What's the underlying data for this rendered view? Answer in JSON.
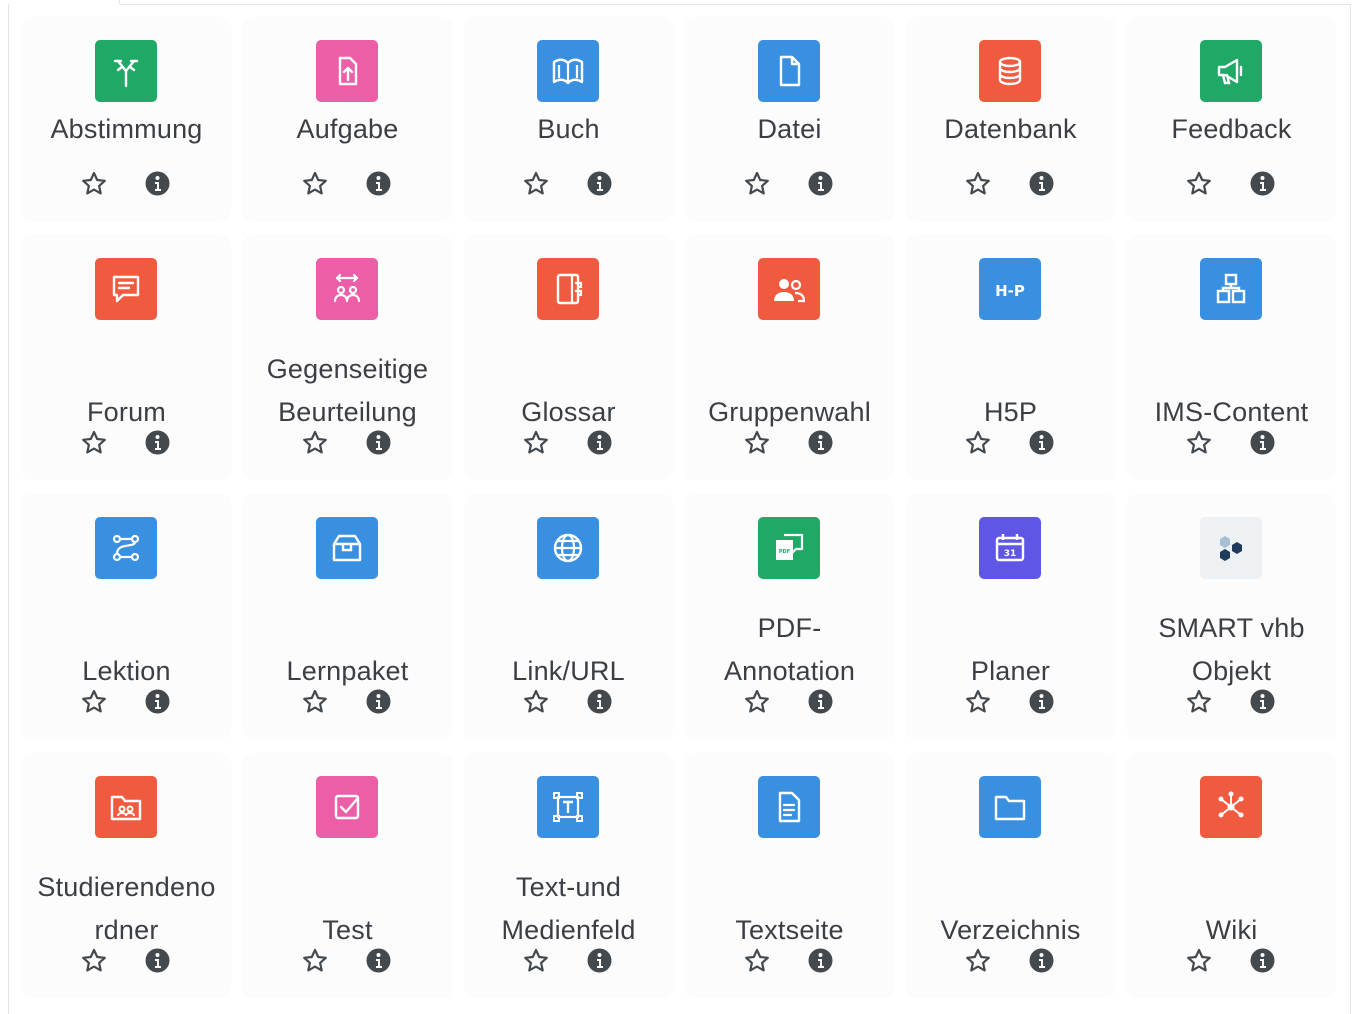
{
  "activities": [
    {
      "label": "Abstimmung",
      "icon": "choice-icon",
      "color": "#1fa866"
    },
    {
      "label": "Aufgabe",
      "icon": "assignment-icon",
      "color": "#ec5fa8"
    },
    {
      "label": "Buch",
      "icon": "book-icon",
      "color": "#3a90e0"
    },
    {
      "label": "Datei",
      "icon": "file-icon",
      "color": "#3a90e0"
    },
    {
      "label": "Datenbank",
      "icon": "database-icon",
      "color": "#f05a3e"
    },
    {
      "label": "Feedback",
      "icon": "megaphone-icon",
      "color": "#1fa866"
    },
    {
      "label": "Forum",
      "icon": "forum-icon",
      "color": "#f05a3e"
    },
    {
      "label": "Gegenseitige Beurteilung",
      "icon": "workshop-icon",
      "color": "#ec5fa8"
    },
    {
      "label": "Glossar",
      "icon": "glossary-icon",
      "color": "#f05a3e"
    },
    {
      "label": "Gruppenwahl",
      "icon": "group-icon",
      "color": "#f05a3e"
    },
    {
      "label": "H5P",
      "icon": "h5p-icon",
      "color": "#3a90e0"
    },
    {
      "label": "IMS-Content",
      "icon": "ims-icon",
      "color": "#3a90e0"
    },
    {
      "label": "Lektion",
      "icon": "lesson-icon",
      "color": "#3a90e0"
    },
    {
      "label": "Lernpaket",
      "icon": "package-icon",
      "color": "#3a90e0"
    },
    {
      "label": "Link/URL",
      "icon": "globe-icon",
      "color": "#3a90e0"
    },
    {
      "label": "PDF-Annotation",
      "icon": "pdf-annotation-icon",
      "color": "#1fa866"
    },
    {
      "label": "Planer",
      "icon": "calendar-icon",
      "color": "#6056e6"
    },
    {
      "label": "SMART vhb Objekt",
      "icon": "smart-vhb-icon",
      "color": "#eef1f4"
    },
    {
      "label": "Studierendenordner",
      "icon": "student-folder-icon",
      "color": "#f05a3e"
    },
    {
      "label": "Test",
      "icon": "quiz-icon",
      "color": "#ec5fa8"
    },
    {
      "label": "Text-und Medienfeld",
      "icon": "text-media-icon",
      "color": "#3a90e0"
    },
    {
      "label": "Textseite",
      "icon": "page-icon",
      "color": "#3a90e0"
    },
    {
      "label": "Verzeichnis",
      "icon": "folder-icon",
      "color": "#3a90e0"
    },
    {
      "label": "Wiki",
      "icon": "wiki-icon",
      "color": "#f05a3e"
    }
  ],
  "display_lines": [
    [
      "Abstimmung"
    ],
    [
      "Aufgabe"
    ],
    [
      "Buch"
    ],
    [
      "Datei"
    ],
    [
      "Datenbank"
    ],
    [
      "Feedback"
    ],
    [
      "Forum"
    ],
    [
      "Gegenseitige",
      "Beurteilung"
    ],
    [
      "Glossar"
    ],
    [
      "Gruppenwahl"
    ],
    [
      "H5P"
    ],
    [
      "IMS-Content"
    ],
    [
      "Lektion"
    ],
    [
      "Lernpaket"
    ],
    [
      "Link/URL"
    ],
    [
      "PDF-",
      "Annotation"
    ],
    [
      "Planer"
    ],
    [
      "SMART vhb",
      "Objekt"
    ],
    [
      "Studierendeno",
      "rdner"
    ],
    [
      "Test"
    ],
    [
      "Text-und",
      "Medienfeld"
    ],
    [
      "Textseite"
    ],
    [
      "Verzeichnis"
    ],
    [
      "Wiki"
    ]
  ],
  "actions": {
    "star_icon": "star-outline-icon",
    "info_icon": "info-circle-icon"
  }
}
